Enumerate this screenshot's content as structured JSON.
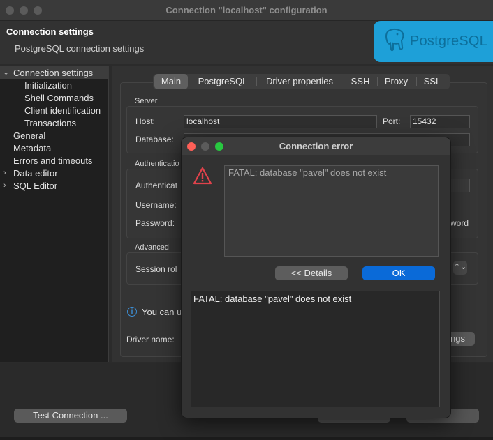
{
  "window": {
    "title": "Connection \"localhost\" configuration"
  },
  "header": {
    "title": "Connection settings",
    "subtitle": "PostgreSQL connection settings",
    "logo_text": "PostgreSQL"
  },
  "sidebar": {
    "items": [
      {
        "label": "Connection settings"
      },
      {
        "label": "Initialization"
      },
      {
        "label": "Shell Commands"
      },
      {
        "label": "Client identification"
      },
      {
        "label": "Transactions"
      },
      {
        "label": "General"
      },
      {
        "label": "Metadata"
      },
      {
        "label": "Errors and timeouts"
      },
      {
        "label": "Data editor"
      },
      {
        "label": "SQL Editor"
      }
    ]
  },
  "tabs": [
    {
      "label": "Main",
      "active": true
    },
    {
      "label": "PostgreSQL"
    },
    {
      "label": "Driver properties"
    },
    {
      "label": "SSH"
    },
    {
      "label": "Proxy"
    },
    {
      "label": "SSL"
    }
  ],
  "server": {
    "group_label": "Server",
    "host_label": "Host:",
    "host_value": "localhost",
    "port_label": "Port:",
    "port_value": "15432",
    "database_label": "Database:"
  },
  "auth": {
    "group_label": "Authenticatio",
    "auth_label": "Authenticat",
    "username_label": "Username:",
    "password_label": "Password:",
    "save_password_fragment": "word"
  },
  "advanced": {
    "group_label": "Advanced",
    "session_role_label": "Session rol"
  },
  "info": {
    "text": "You can u"
  },
  "driver": {
    "label": "Driver name:",
    "settings_fragment": "ngs"
  },
  "bottom": {
    "test_connection_label": "Test Connection ..."
  },
  "dialog": {
    "title": "Connection error",
    "message": "FATAL: database \"pavel\" does not exist",
    "details_button": "<< Details",
    "ok_button": "OK",
    "details_text": "FATAL: database \"pavel\" does not exist"
  },
  "colors": {
    "accent_blue": "#0a6ad8",
    "logo_blue": "#1ea0d8",
    "warning_red": "#e0424b",
    "close_red": "#fe5f57",
    "minimize_yellow": "#febc2e",
    "maximize_green": "#28c840"
  }
}
